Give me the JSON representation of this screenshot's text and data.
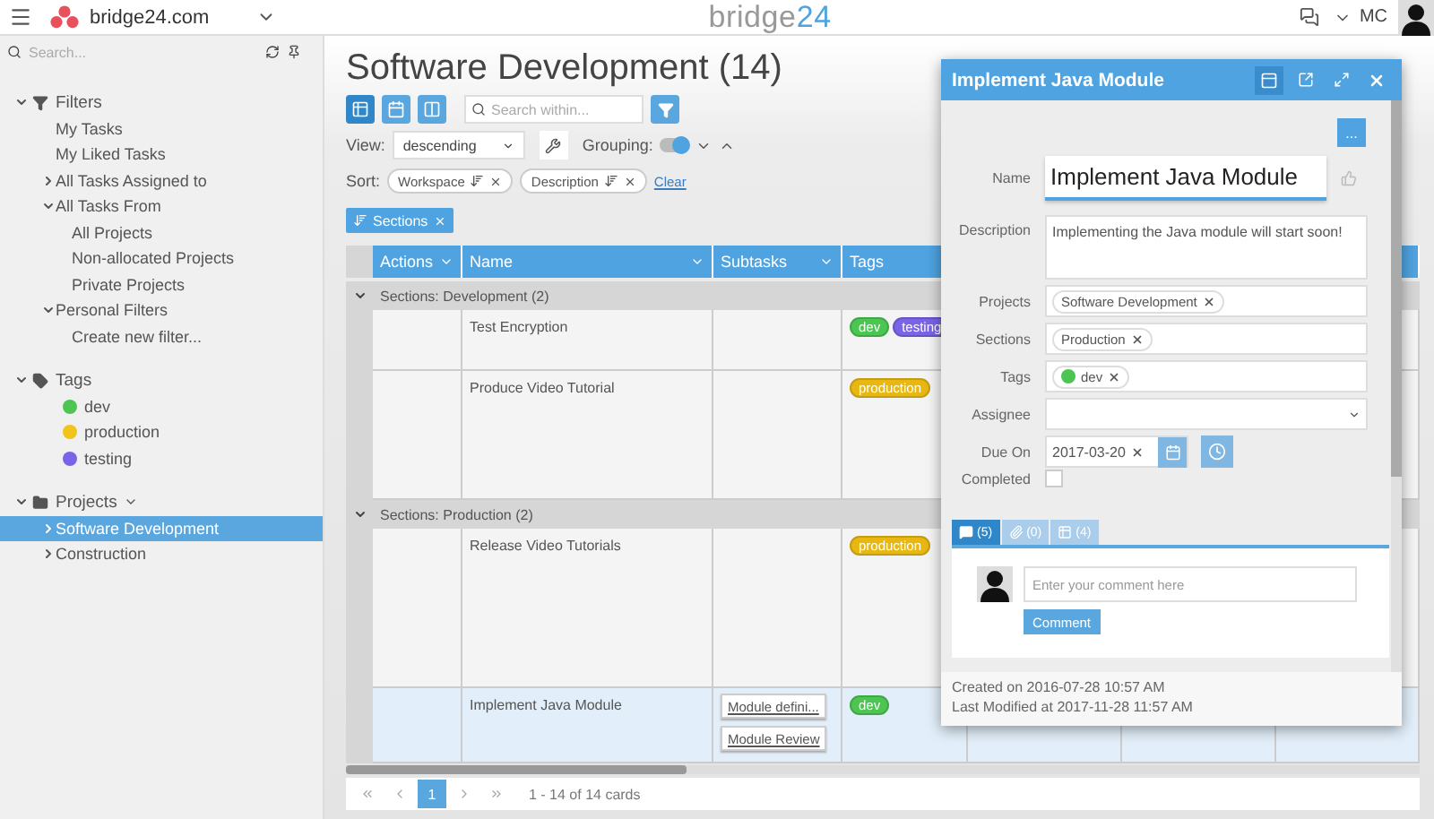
{
  "header": {
    "brand": "bridge24.com",
    "logo": {
      "word": "bridge",
      "accent": "24"
    },
    "user_initials": "MC"
  },
  "sidebar": {
    "search": {
      "placeholder": "Search..."
    },
    "tree": [
      {
        "label": "Filters",
        "kind": "filter",
        "expanded": true,
        "children": [
          {
            "label": "My Tasks",
            "selected": false
          },
          {
            "label": "My Liked Tasks",
            "selected": false
          },
          {
            "label": "All Tasks Assigned to",
            "expanded": false,
            "selected": false
          },
          {
            "label": "All Tasks From",
            "expanded": true,
            "selected": false,
            "children": [
              {
                "label": "All Projects",
                "selected": false
              },
              {
                "label": "Non-allocated Projects",
                "selected": false
              },
              {
                "label": "Private Projects",
                "selected": false
              }
            ]
          },
          {
            "label": "Personal Filters",
            "expanded": true,
            "selected": false,
            "children": [
              {
                "label": "Create new filter...",
                "selected": false
              }
            ]
          }
        ]
      },
      {
        "label": "Tags",
        "kind": "tag",
        "expanded": true,
        "children": [
          {
            "label": "dev",
            "color": "#4cc552",
            "selected": false
          },
          {
            "label": "production",
            "color": "#f0c419",
            "selected": false
          },
          {
            "label": "testing",
            "color": "#7a63e6",
            "selected": false
          }
        ]
      },
      {
        "label": "Projects",
        "kind": "folder",
        "expanded": true,
        "children": [
          {
            "label": "Software Development",
            "expanded": false,
            "selected": true
          },
          {
            "label": "Construction",
            "expanded": false,
            "selected": false
          }
        ]
      }
    ]
  },
  "main": {
    "title": "Software Development (14)",
    "views": [
      {
        "kind": "list",
        "selected": true
      },
      {
        "kind": "calendar",
        "selected": false
      },
      {
        "kind": "board",
        "selected": false
      }
    ],
    "search": {
      "placeholder": "Search within..."
    },
    "view": {
      "label": "View:",
      "value": "descending"
    },
    "grouping": {
      "label": "Grouping:",
      "on": true
    },
    "sort": {
      "label": "Sort:",
      "chips": [
        "Workspace",
        "Description"
      ],
      "clear": "Clear"
    },
    "group_chips": [
      "Sections"
    ],
    "table": {
      "columns": [
        "Actions",
        "Name",
        "Subtasks",
        "Tags"
      ],
      "groups": [
        {
          "label": "Sections: Development (2)",
          "expanded": true,
          "rows": [
            {
              "name": "Test Encryption",
              "selected": false,
              "tags": [
                {
                  "label": "dev",
                  "color": "#4cc552"
                },
                {
                  "label": "testing",
                  "color": "#7a63e6"
                }
              ]
            },
            {
              "name": "Produce Video Tutorial",
              "selected": false,
              "tags": [
                {
                  "label": "production",
                  "color": "#e8b812"
                }
              ]
            }
          ]
        },
        {
          "label": "Sections: Production (2)",
          "expanded": true,
          "rows": [
            {
              "name": "Release Video Tutorials",
              "selected": false,
              "tags": [
                {
                  "label": "production",
                  "color": "#e8b812"
                }
              ]
            },
            {
              "name": "Implement Java Module",
              "selected": true,
              "subtasks": [
                "Module defini...",
                "Module Review"
              ],
              "tags": [
                {
                  "label": "dev",
                  "color": "#4cc552"
                }
              ]
            }
          ]
        }
      ]
    },
    "pager": {
      "pages": [
        {
          "label": "1",
          "selected": true
        }
      ],
      "info": "1 - 14 of 14 cards"
    }
  },
  "task_dialog": {
    "title": "Implement Java Module",
    "more": "...",
    "fields": [
      {
        "kind": "name",
        "label": "Name",
        "value": "Implement Java Module"
      },
      {
        "kind": "text",
        "label": "Description",
        "value": "Implementing the Java module will start soon!"
      },
      {
        "kind": "chips",
        "label": "Projects",
        "chips": [
          {
            "label": "Software Development"
          }
        ]
      },
      {
        "kind": "chips",
        "label": "Sections",
        "chips": [
          {
            "label": "Production"
          }
        ]
      },
      {
        "kind": "chips",
        "label": "Tags",
        "chips": [
          {
            "label": "dev",
            "color": "#4cc552"
          }
        ]
      },
      {
        "kind": "select",
        "label": "Assignee"
      },
      {
        "kind": "date",
        "label": "Due On",
        "value": "2017-03-20"
      },
      {
        "kind": "checkbox",
        "label": "Completed",
        "checked": false
      }
    ],
    "tabs": [
      {
        "kind": "comments",
        "count": "(5)",
        "selected": true
      },
      {
        "kind": "attachments",
        "count": "(0)",
        "selected": false
      },
      {
        "kind": "checklist",
        "count": "(4)",
        "selected": false
      }
    ],
    "comment": {
      "placeholder": "Enter your comment here",
      "button": "Comment"
    },
    "created": "Created on 2016-07-28 10:57 AM",
    "modified": "Last Modified at 2017-11-28 11:57 AM"
  }
}
